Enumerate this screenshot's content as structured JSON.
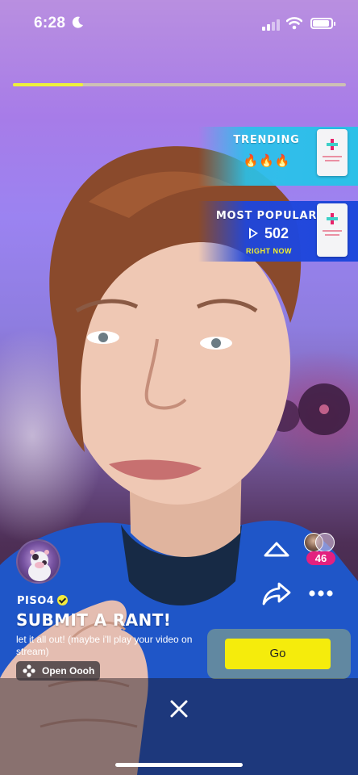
{
  "status_bar": {
    "time": "6:28",
    "focus_icon": "moon-icon",
    "signal_icon": "cellular-signal-icon",
    "wifi_icon": "wifi-icon",
    "battery_icon": "battery-icon",
    "battery_level": 0.9
  },
  "video": {
    "progress": 0.21
  },
  "promos": {
    "trending": {
      "title": "TRENDING",
      "fires": "🔥🔥🔥"
    },
    "most_popular": {
      "title": "MOST POPULAR",
      "count": "502",
      "subtitle": "RIGHT NOW"
    }
  },
  "actions": {
    "upvote_icon": "chevron-up-icon",
    "share_icon": "share-arrow-icon",
    "more_icon": "more-dots-icon",
    "viewer_count": "46"
  },
  "creator": {
    "username": "PISO4",
    "verified_icon": "verified-badge-icon"
  },
  "post": {
    "headline": "SUBMIT A RANT!",
    "description": "let it all out! (maybe i'll play your video on stream)",
    "open_label": "Open Oooh"
  },
  "cta": {
    "go_label": "Go"
  },
  "controls": {
    "close_icon": "close-icon"
  },
  "colors": {
    "accent_yellow": "#f5ec0c",
    "badge_pink": "#e3217f",
    "trending_cyan": "#2bc0e8",
    "popular_blue": "#1f48dc"
  }
}
